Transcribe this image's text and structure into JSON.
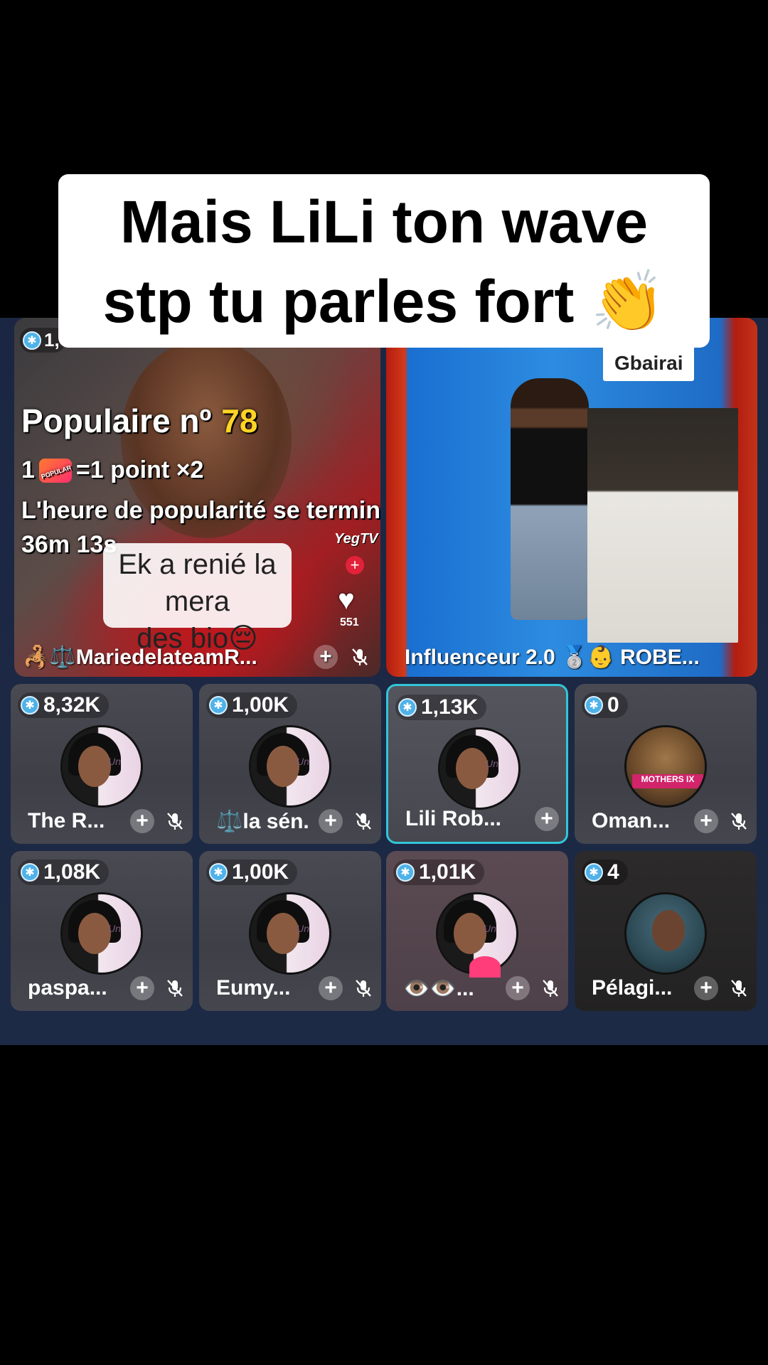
{
  "caption": {
    "line1": "Mais LiLi ton wave",
    "line2": "stp tu parles fort 👏"
  },
  "host_tile": {
    "count": "1,",
    "popular_title": "Populaire nº",
    "popular_rank": "78",
    "rule_left": "1",
    "popular_icon_text": "POPULAR",
    "rule_right": "=1 point ×2",
    "ends_text": "L'heure de popularité se termine dans :",
    "timer": "36m 13s",
    "caption_line1": "Ek a renié la mera",
    "caption_line2": "des bio😔",
    "brand": "YegTV",
    "likes": "551",
    "name": "🦂⚖️MariedelateamR..."
  },
  "guest_tile": {
    "badge": "Gbairai",
    "name": "Influenceur 2.0 🥈👶 ROBE..."
  },
  "grid": [
    {
      "count": "8,32K",
      "name": "The R..."
    },
    {
      "count": "1,00K",
      "name": "⚖️la sén..."
    },
    {
      "count": "1,13K",
      "name": "Lili Rob..."
    },
    {
      "count": "0",
      "name": "Oman...",
      "avatar_text": "MOTHERS IX"
    },
    {
      "count": "1,08K",
      "name": "paspa..."
    },
    {
      "count": "1,00K",
      "name": "Eumy..."
    },
    {
      "count": "1,01K",
      "name": "👁️👁️..."
    },
    {
      "count": "4",
      "name": "Pélagi..."
    }
  ],
  "icons": {
    "badge": "star-badge-icon",
    "plus": "+",
    "mute": "mic-off-icon"
  },
  "colors": {
    "accent_active_border": "#32c6d8",
    "rank_yellow": "#ffd426",
    "badge_blue": "#4fb2e8"
  }
}
